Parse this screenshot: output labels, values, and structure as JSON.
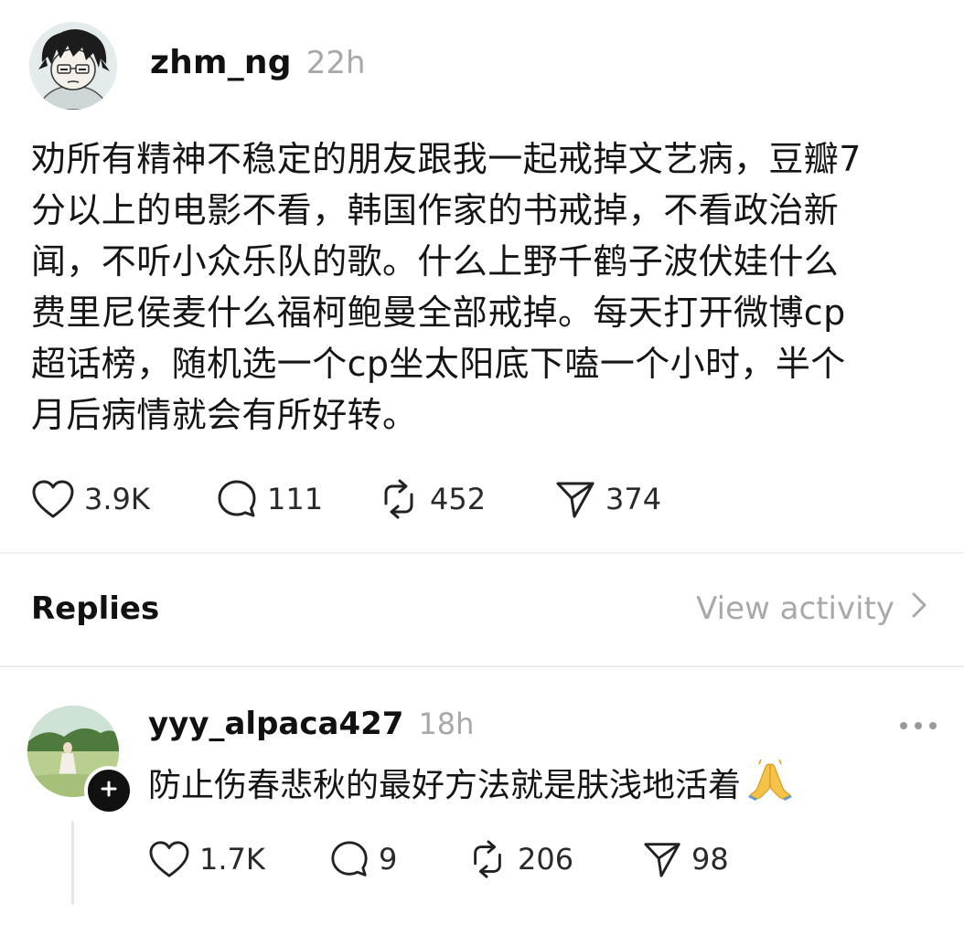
{
  "post": {
    "username": "zhm_ng",
    "time": "22h",
    "text": "劝所有精神不稳定的朋友跟我一起戒掉文艺病，豆瓣7\n分以上的电影不看，韩国作家的书戒掉，不看政治新\n闻，不听小众乐队的歌。什么上野千鹤子波伏娃什么\n费里尼侯麦什么福柯鲍曼全部戒掉。每天打开微博cp\n超话榜，随机选一个cp坐太阳底下嗑一个小时，半个\n月后病情就会有所好转。",
    "likes": "3.9K",
    "comments": "111",
    "reposts": "452",
    "shares": "374"
  },
  "replies_section": {
    "title": "Replies",
    "view_activity": "View activity"
  },
  "reply": {
    "username": "yyy_alpaca427",
    "time": "18h",
    "text": "防止伤春悲秋的最好方法就是肤浅地活着",
    "emoji": "folded-hands-emoji",
    "likes": "1.7K",
    "comments": "9",
    "reposts": "206",
    "shares": "98"
  },
  "icons": {
    "like": "heart-icon",
    "comment": "comment-bubble-icon",
    "repost": "repost-arrows-icon",
    "share": "send-paper-plane-icon",
    "more": "more-dots-icon",
    "follow": "plus-icon",
    "chevron": "chevron-right-icon"
  },
  "colors": {
    "text": "#111111",
    "muted": "#a8a8a8",
    "divider": "#ededed"
  }
}
